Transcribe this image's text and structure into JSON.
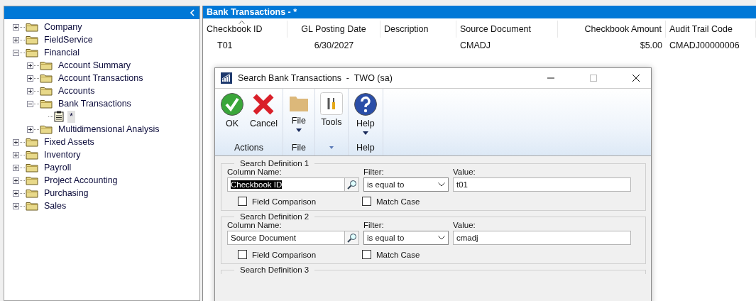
{
  "navigation_pane": {
    "tree": [
      {
        "label": "Company",
        "kind": "folder",
        "expanded": false,
        "selected": false
      },
      {
        "label": "FieldService",
        "kind": "folder",
        "expanded": false,
        "selected": false
      },
      {
        "label": "Financial",
        "kind": "folder",
        "expanded": true,
        "selected": false,
        "children": [
          {
            "label": "Account Summary",
            "kind": "folder",
            "expanded": false,
            "selected": false
          },
          {
            "label": "Account Transactions",
            "kind": "folder",
            "expanded": false,
            "selected": false
          },
          {
            "label": "Accounts",
            "kind": "folder",
            "expanded": false,
            "selected": false
          },
          {
            "label": "Bank Transactions",
            "kind": "folder",
            "expanded": true,
            "selected": false,
            "children": [
              {
                "label": "*",
                "kind": "document",
                "selected": true
              }
            ]
          },
          {
            "label": "Multidimensional  Analysis",
            "kind": "folder",
            "expanded": false,
            "selected": false
          }
        ]
      },
      {
        "label": "Fixed Assets",
        "kind": "folder",
        "expanded": false,
        "selected": false
      },
      {
        "label": "Inventory",
        "kind": "folder",
        "expanded": false,
        "selected": false
      },
      {
        "label": "Payroll",
        "kind": "folder",
        "expanded": false,
        "selected": false
      },
      {
        "label": "Project Accounting",
        "kind": "folder",
        "expanded": false,
        "selected": false
      },
      {
        "label": "Purchasing",
        "kind": "folder",
        "expanded": false,
        "selected": false
      },
      {
        "label": "Sales",
        "kind": "folder",
        "expanded": false,
        "selected": false
      }
    ]
  },
  "list_view": {
    "title": "Bank Transactions - *",
    "columns": [
      {
        "label": "Checkbook ID",
        "kind": "id",
        "sorted": true
      },
      {
        "label": "GL Posting Date",
        "kind": "date",
        "sorted": false
      },
      {
        "label": "Description",
        "kind": "text",
        "sorted": false
      },
      {
        "label": "Source Document",
        "kind": "text",
        "sorted": false
      },
      {
        "label": "Checkbook Amount",
        "kind": "amount",
        "sorted": false
      },
      {
        "label": "Audit Trail Code",
        "kind": "text",
        "sorted": false
      }
    ],
    "rows": [
      {
        "cells": [
          "T01",
          "6/30/2027",
          "",
          "CMADJ",
          "$5.00",
          "CMADJ00000006"
        ]
      }
    ]
  },
  "dialog": {
    "title": "Search Bank Transactions  -  TWO (sa)",
    "ribbon_groups": [
      {
        "label": "Actions",
        "buttons": [
          {
            "label": "OK",
            "kind": "ok",
            "dropdown": false
          },
          {
            "label": "Cancel",
            "kind": "cancel",
            "dropdown": false
          }
        ]
      },
      {
        "label": "File",
        "buttons": [
          {
            "label": "File",
            "kind": "file",
            "dropdown": true
          }
        ]
      },
      {
        "launcher": true,
        "buttons": [
          {
            "label": "Tools",
            "kind": "tools",
            "dropdown": false
          }
        ]
      },
      {
        "label": "Help",
        "buttons": [
          {
            "label": "Help",
            "kind": "help",
            "dropdown": true
          }
        ]
      }
    ],
    "search_definitions": [
      {
        "title": "Search Definition 1",
        "column_name_label": "Column Name:",
        "column_name": "Checkbook ID",
        "column_name_selected": true,
        "filter_label": "Filter:",
        "filter": "is equal to",
        "value_label": "Value:",
        "value": "t01",
        "field_comparison_label": "Field Comparison",
        "field_comparison": false,
        "match_case_label": "Match Case",
        "match_case": false
      },
      {
        "title": "Search Definition 2",
        "column_name_label": "Column Name:",
        "column_name": "Source Document",
        "column_name_selected": false,
        "filter_label": "Filter:",
        "filter": "is equal to",
        "value_label": "Value:",
        "value": "cmadj",
        "field_comparison_label": "Field Comparison",
        "field_comparison": false,
        "match_case_label": "Match Case",
        "match_case": false
      },
      {
        "title": "Search Definition 3"
      }
    ]
  }
}
